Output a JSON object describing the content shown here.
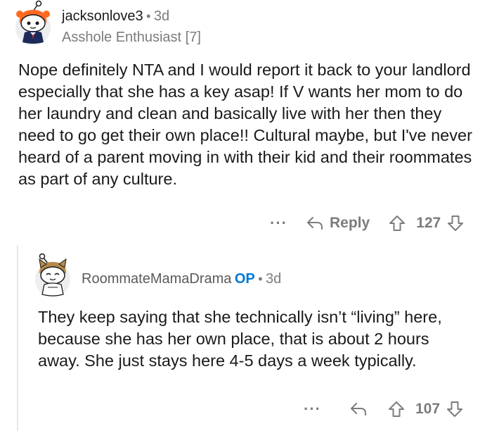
{
  "comments": [
    {
      "username": "jacksonlove3",
      "separator": "•",
      "age": "3d",
      "flair": "Asshole Enthusiast [7]",
      "body": "Nope definitely NTA and I would report it back to your landlord especially that she has a key asap! If V wants her mom to do her laundry and clean and basically live with her then they need to go get their own place!! Cultural maybe,  but I've never heard of a parent moving in with their kid and their roommates as part of any culture.",
      "more_label": "···",
      "reply_label": "Reply",
      "score": "127"
    },
    {
      "username": "RoommateMamaDrama",
      "op_badge": "OP",
      "separator": "•",
      "age": "3d",
      "body": "They keep saying that she technically isn’t “living” here, because she has her own place, that is about 2 hours away. She just stays here 4-5 days a week typically.",
      "more_label": "···",
      "score": "107"
    }
  ],
  "colors": {
    "text": "#1a1a1b",
    "meta": "#7c7c7c",
    "op": "#0079d3",
    "thread_line": "#e6e6e6"
  },
  "icons": [
    "reply-arrow-icon",
    "upvote-arrow-icon",
    "downvote-arrow-icon",
    "more-options-icon"
  ]
}
